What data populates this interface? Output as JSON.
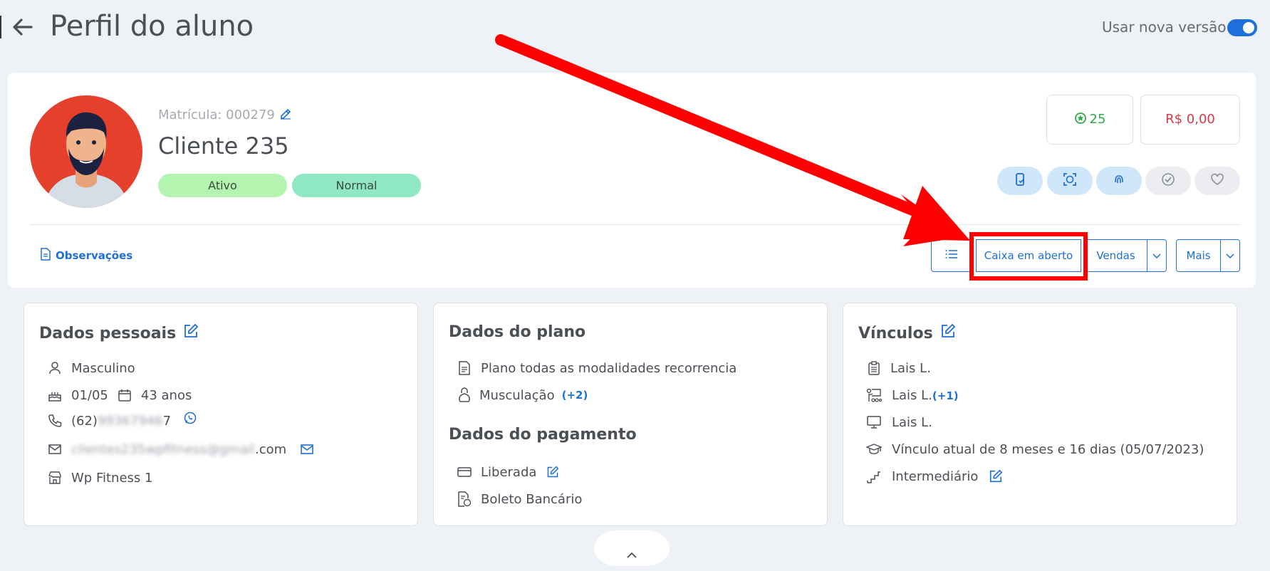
{
  "header": {
    "title": "Perfil do aluno",
    "toggle_label": "Usar nova versão",
    "toggle_on": true
  },
  "profile": {
    "matricula": "Matrícula: 000279",
    "name": "Cliente 235",
    "status_badges": [
      "Ativo",
      "Normal"
    ],
    "points": "25",
    "balance": "R$ 0,00"
  },
  "toolbar": {
    "observacoes": "Observações",
    "caixa_em_aberto": "Caixa em aberto",
    "vendas": "Vendas",
    "mais": "Mais"
  },
  "dados_pessoais": {
    "title": "Dados pessoais",
    "gender": "Masculino",
    "birthday": "01/05",
    "age": "43 anos",
    "phone_prefix": "(62)",
    "phone_hidden": "99367946",
    "phone_suffix": "7",
    "email_hidden": "clientes235wpfitness@gmail",
    "email_suffix": ".com",
    "unit": "Wp Fitness 1"
  },
  "dados_plano": {
    "title": "Dados do plano",
    "plan": "Plano todas as modalidades recorrencia",
    "modality": "Musculação",
    "modality_more": "(+2)"
  },
  "dados_pagamento": {
    "title": "Dados do pagamento",
    "status": "Liberada",
    "method": "Boleto Bancário"
  },
  "vinculos": {
    "title": "Vínculos",
    "consultor": "Lais L.",
    "professor": "Lais L.",
    "professor_more": "(+1)",
    "professor_tv": "Lais L.",
    "vinculo_atual": "Vínculo atual de 8 meses e 16 dias (05/07/2023)",
    "nivel": "Intermediário"
  },
  "colors": {
    "primary": "#1e6fd9",
    "annotation_red": "#ff0000",
    "ativo_bg": "#b3f5b0",
    "normal_bg": "#8fe7c3"
  }
}
